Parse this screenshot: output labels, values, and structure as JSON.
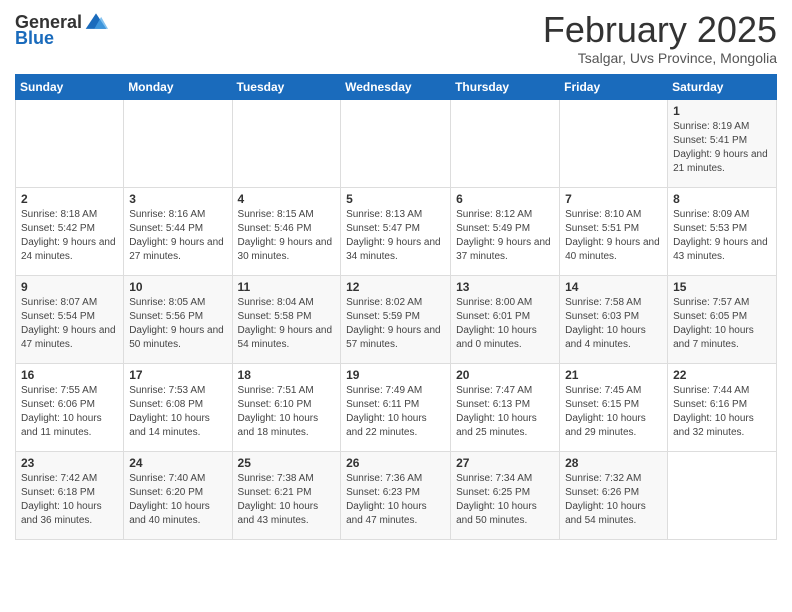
{
  "logo": {
    "general": "General",
    "blue": "Blue"
  },
  "header": {
    "month": "February 2025",
    "location": "Tsalgar, Uvs Province, Mongolia"
  },
  "weekdays": [
    "Sunday",
    "Monday",
    "Tuesday",
    "Wednesday",
    "Thursday",
    "Friday",
    "Saturday"
  ],
  "weeks": [
    [
      {
        "day": "",
        "info": ""
      },
      {
        "day": "",
        "info": ""
      },
      {
        "day": "",
        "info": ""
      },
      {
        "day": "",
        "info": ""
      },
      {
        "day": "",
        "info": ""
      },
      {
        "day": "",
        "info": ""
      },
      {
        "day": "1",
        "info": "Sunrise: 8:19 AM\nSunset: 5:41 PM\nDaylight: 9 hours and 21 minutes."
      }
    ],
    [
      {
        "day": "2",
        "info": "Sunrise: 8:18 AM\nSunset: 5:42 PM\nDaylight: 9 hours and 24 minutes."
      },
      {
        "day": "3",
        "info": "Sunrise: 8:16 AM\nSunset: 5:44 PM\nDaylight: 9 hours and 27 minutes."
      },
      {
        "day": "4",
        "info": "Sunrise: 8:15 AM\nSunset: 5:46 PM\nDaylight: 9 hours and 30 minutes."
      },
      {
        "day": "5",
        "info": "Sunrise: 8:13 AM\nSunset: 5:47 PM\nDaylight: 9 hours and 34 minutes."
      },
      {
        "day": "6",
        "info": "Sunrise: 8:12 AM\nSunset: 5:49 PM\nDaylight: 9 hours and 37 minutes."
      },
      {
        "day": "7",
        "info": "Sunrise: 8:10 AM\nSunset: 5:51 PM\nDaylight: 9 hours and 40 minutes."
      },
      {
        "day": "8",
        "info": "Sunrise: 8:09 AM\nSunset: 5:53 PM\nDaylight: 9 hours and 43 minutes."
      }
    ],
    [
      {
        "day": "9",
        "info": "Sunrise: 8:07 AM\nSunset: 5:54 PM\nDaylight: 9 hours and 47 minutes."
      },
      {
        "day": "10",
        "info": "Sunrise: 8:05 AM\nSunset: 5:56 PM\nDaylight: 9 hours and 50 minutes."
      },
      {
        "day": "11",
        "info": "Sunrise: 8:04 AM\nSunset: 5:58 PM\nDaylight: 9 hours and 54 minutes."
      },
      {
        "day": "12",
        "info": "Sunrise: 8:02 AM\nSunset: 5:59 PM\nDaylight: 9 hours and 57 minutes."
      },
      {
        "day": "13",
        "info": "Sunrise: 8:00 AM\nSunset: 6:01 PM\nDaylight: 10 hours and 0 minutes."
      },
      {
        "day": "14",
        "info": "Sunrise: 7:58 AM\nSunset: 6:03 PM\nDaylight: 10 hours and 4 minutes."
      },
      {
        "day": "15",
        "info": "Sunrise: 7:57 AM\nSunset: 6:05 PM\nDaylight: 10 hours and 7 minutes."
      }
    ],
    [
      {
        "day": "16",
        "info": "Sunrise: 7:55 AM\nSunset: 6:06 PM\nDaylight: 10 hours and 11 minutes."
      },
      {
        "day": "17",
        "info": "Sunrise: 7:53 AM\nSunset: 6:08 PM\nDaylight: 10 hours and 14 minutes."
      },
      {
        "day": "18",
        "info": "Sunrise: 7:51 AM\nSunset: 6:10 PM\nDaylight: 10 hours and 18 minutes."
      },
      {
        "day": "19",
        "info": "Sunrise: 7:49 AM\nSunset: 6:11 PM\nDaylight: 10 hours and 22 minutes."
      },
      {
        "day": "20",
        "info": "Sunrise: 7:47 AM\nSunset: 6:13 PM\nDaylight: 10 hours and 25 minutes."
      },
      {
        "day": "21",
        "info": "Sunrise: 7:45 AM\nSunset: 6:15 PM\nDaylight: 10 hours and 29 minutes."
      },
      {
        "day": "22",
        "info": "Sunrise: 7:44 AM\nSunset: 6:16 PM\nDaylight: 10 hours and 32 minutes."
      }
    ],
    [
      {
        "day": "23",
        "info": "Sunrise: 7:42 AM\nSunset: 6:18 PM\nDaylight: 10 hours and 36 minutes."
      },
      {
        "day": "24",
        "info": "Sunrise: 7:40 AM\nSunset: 6:20 PM\nDaylight: 10 hours and 40 minutes."
      },
      {
        "day": "25",
        "info": "Sunrise: 7:38 AM\nSunset: 6:21 PM\nDaylight: 10 hours and 43 minutes."
      },
      {
        "day": "26",
        "info": "Sunrise: 7:36 AM\nSunset: 6:23 PM\nDaylight: 10 hours and 47 minutes."
      },
      {
        "day": "27",
        "info": "Sunrise: 7:34 AM\nSunset: 6:25 PM\nDaylight: 10 hours and 50 minutes."
      },
      {
        "day": "28",
        "info": "Sunrise: 7:32 AM\nSunset: 6:26 PM\nDaylight: 10 hours and 54 minutes."
      },
      {
        "day": "",
        "info": ""
      }
    ]
  ]
}
